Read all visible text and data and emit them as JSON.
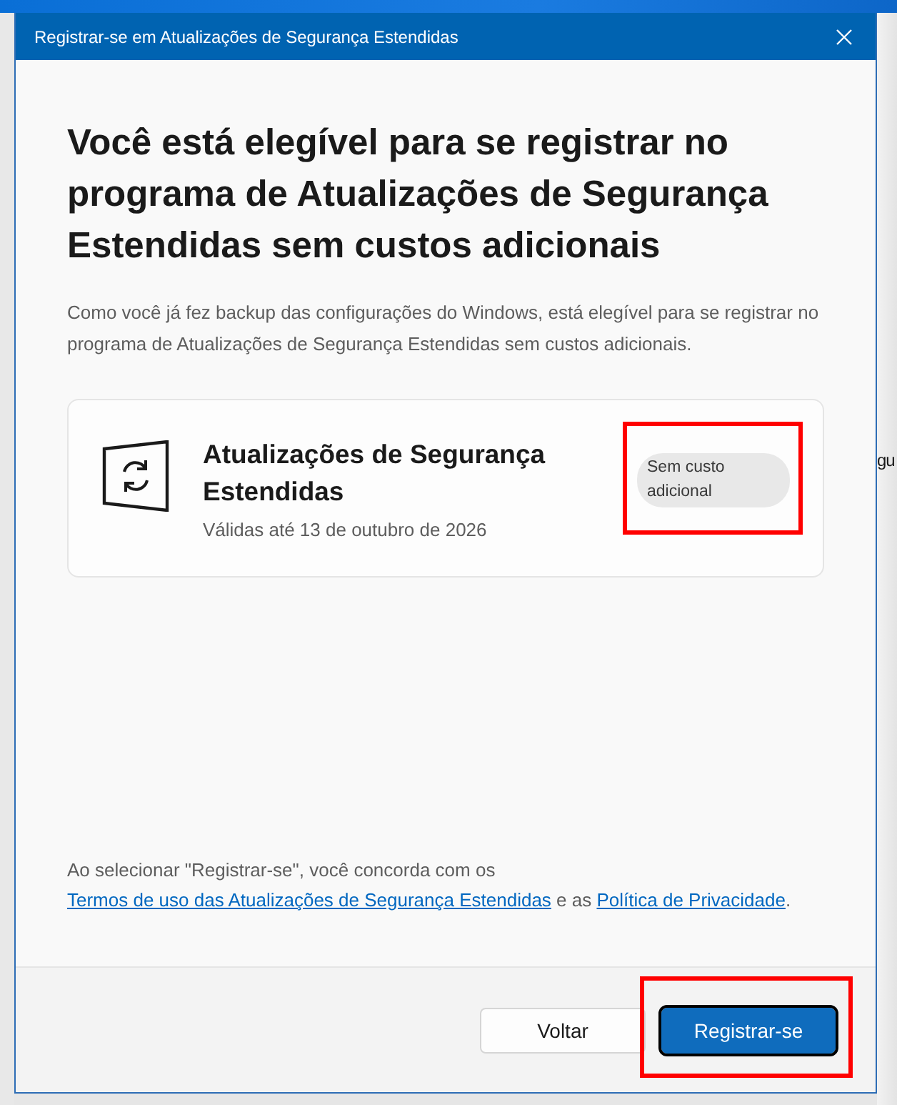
{
  "window": {
    "title": "Registrar-se em Atualizações de Segurança Estendidas"
  },
  "heading": "Você está elegível para se registrar no programa de Atualizações de Segurança Estendidas sem custos adicionais",
  "description": "Como você já fez backup das configurações do Windows, está elegível para se registrar no programa de Atualizações de Segurança Estendidas sem custos adicionais.",
  "card": {
    "title": "Atualizações de Segurança Estendidas",
    "subtitle": "Válidas até 13 de outubro de 2026",
    "badge": {
      "text": "Sem custo adicional",
      "highlighted": true
    }
  },
  "consent": {
    "text_before": "Ao selecionar \"Registrar-se\", você concorda com os",
    "link_1": "Termos de uso das Atualizações de Segurança Estendidas",
    "text_middle": "e as",
    "link_2": "Política de Privacidade",
    "text_after": "."
  },
  "buttons": [
    {
      "label": "Voltar",
      "kind": "secondary",
      "highlighted": false
    },
    {
      "label": "Registrar-se",
      "kind": "primary",
      "highlighted": true
    }
  ],
  "background_window": {
    "text": "gu"
  }
}
